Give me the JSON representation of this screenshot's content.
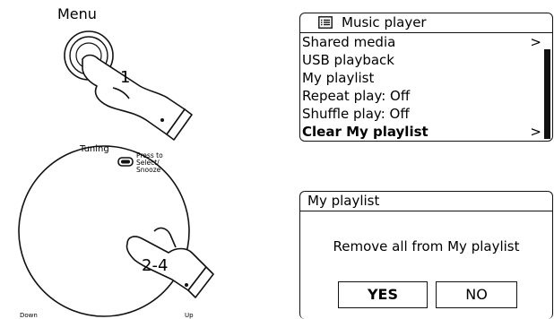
{
  "left_panel": {
    "menu_label": "Menu",
    "step1": "1",
    "tuning_label": "Tuning",
    "press_to": [
      "Press to",
      "Select/",
      "Snooze"
    ],
    "step2": "2-4",
    "down_label": "Down",
    "up_label": "Up"
  },
  "music_menu": {
    "title": "Music player",
    "icon": "menu-list-icon",
    "items": [
      {
        "label": "Shared media",
        "chevron": ">"
      },
      {
        "label": "USB playback",
        "chevron": ""
      },
      {
        "label": "My playlist",
        "chevron": ""
      },
      {
        "label": "Repeat play: Off",
        "chevron": ""
      },
      {
        "label": "Shuffle play: Off",
        "chevron": ""
      },
      {
        "label": "Clear My playlist",
        "chevron": ">"
      }
    ],
    "selected_index": 5
  },
  "playlist_dialog": {
    "title": "My playlist",
    "message": "Remove all from My playlist",
    "yes_label": "YES",
    "no_label": "NO"
  }
}
